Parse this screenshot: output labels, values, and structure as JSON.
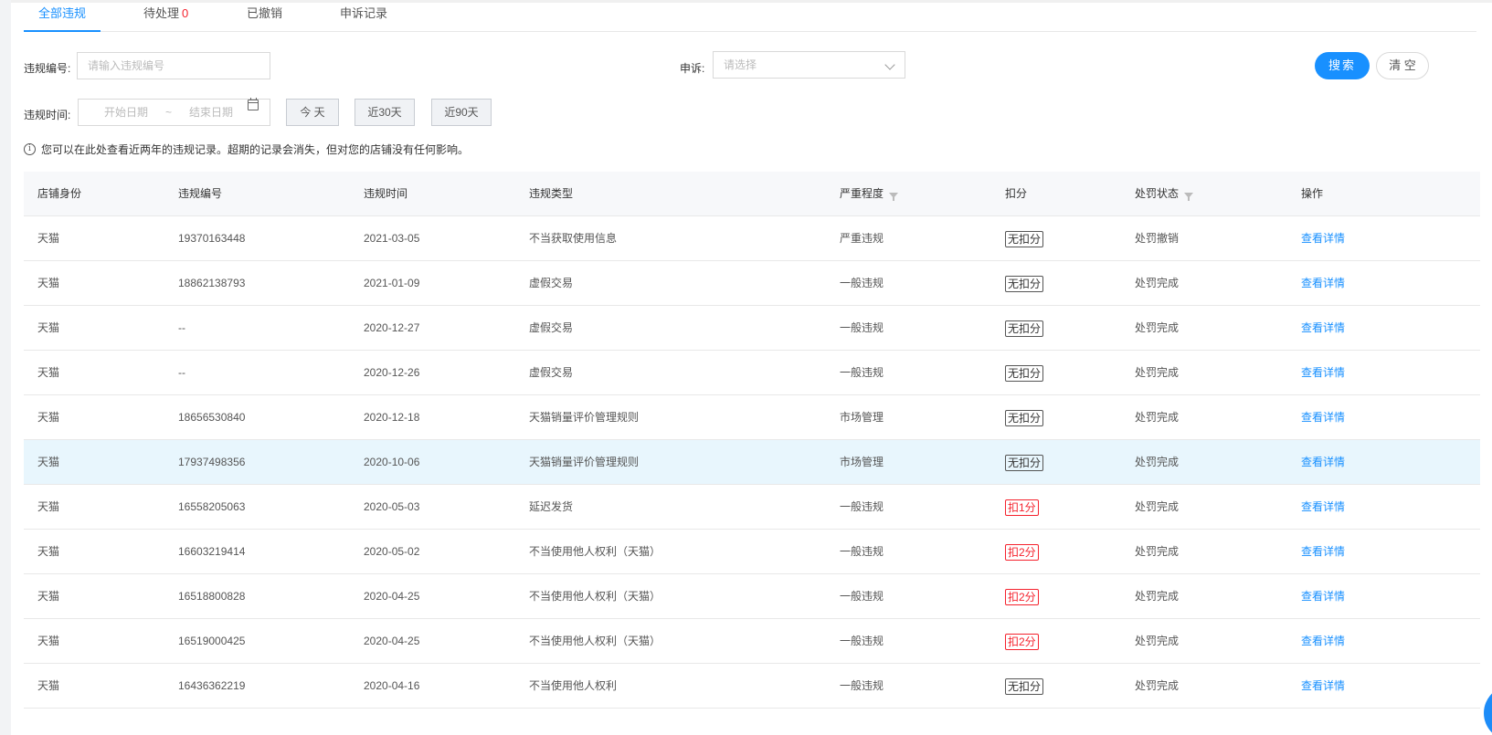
{
  "tabs": [
    {
      "label": "全部违规",
      "count": ""
    },
    {
      "label": "待处理",
      "count": "0"
    },
    {
      "label": "已撤销",
      "count": ""
    },
    {
      "label": "申诉记录",
      "count": ""
    }
  ],
  "filters": {
    "violation_no_label": "违规编号:",
    "violation_no_placeholder": "请输入违规编号",
    "appeal_label": "申诉:",
    "appeal_placeholder": "请选择",
    "time_label": "违规时间:",
    "start_date_placeholder": "开始日期",
    "range_sep": "~",
    "end_date_placeholder": "结束日期",
    "today_label": "今 天",
    "last30_label": "近30天",
    "last90_label": "近90天",
    "search_label": "搜索",
    "clear_label": "清 空"
  },
  "notice": "您可以在此处查看近两年的违规记录。超期的记录会消失，但对您的店铺没有任何影响。",
  "table": {
    "headers": [
      "店铺身份",
      "违规编号",
      "违规时间",
      "违规类型",
      "严重程度",
      "扣分",
      "处罚状态",
      "操作"
    ],
    "action_label": "查看详情",
    "rows": [
      {
        "shop": "天猫",
        "no": "19370163448",
        "time": "2021-03-05",
        "type": "不当获取使用信息",
        "severity": "严重违规",
        "points": "无扣分",
        "points_red": false,
        "status": "处罚撤销"
      },
      {
        "shop": "天猫",
        "no": "18862138793",
        "time": "2021-01-09",
        "type": "虚假交易",
        "severity": "一般违规",
        "points": "无扣分",
        "points_red": false,
        "status": "处罚完成"
      },
      {
        "shop": "天猫",
        "no": "--",
        "time": "2020-12-27",
        "type": "虚假交易",
        "severity": "一般违规",
        "points": "无扣分",
        "points_red": false,
        "status": "处罚完成"
      },
      {
        "shop": "天猫",
        "no": "--",
        "time": "2020-12-26",
        "type": "虚假交易",
        "severity": "一般违规",
        "points": "无扣分",
        "points_red": false,
        "status": "处罚完成"
      },
      {
        "shop": "天猫",
        "no": "18656530840",
        "time": "2020-12-18",
        "type": "天猫销量评价管理规则",
        "severity": "市场管理",
        "points": "无扣分",
        "points_red": false,
        "status": "处罚完成"
      },
      {
        "shop": "天猫",
        "no": "17937498356",
        "time": "2020-10-06",
        "type": "天猫销量评价管理规则",
        "severity": "市场管理",
        "points": "无扣分",
        "points_red": false,
        "status": "处罚完成"
      },
      {
        "shop": "天猫",
        "no": "16558205063",
        "time": "2020-05-03",
        "type": "延迟发货",
        "severity": "一般违规",
        "points": "扣1分",
        "points_red": true,
        "status": "处罚完成"
      },
      {
        "shop": "天猫",
        "no": "16603219414",
        "time": "2020-05-02",
        "type": "不当使用他人权利（天猫）",
        "severity": "一般违规",
        "points": "扣2分",
        "points_red": true,
        "status": "处罚完成"
      },
      {
        "shop": "天猫",
        "no": "16518800828",
        "time": "2020-04-25",
        "type": "不当使用他人权利（天猫）",
        "severity": "一般违规",
        "points": "扣2分",
        "points_red": true,
        "status": "处罚完成"
      },
      {
        "shop": "天猫",
        "no": "16519000425",
        "time": "2020-04-25",
        "type": "不当使用他人权利（天猫）",
        "severity": "一般违规",
        "points": "扣2分",
        "points_red": true,
        "status": "处罚完成"
      },
      {
        "shop": "天猫",
        "no": "16436362219",
        "time": "2020-04-16",
        "type": "不当使用他人权利",
        "severity": "一般违规",
        "points": "无扣分",
        "points_red": false,
        "status": "处罚完成"
      }
    ]
  },
  "colors": {
    "accent": "#1890ff",
    "danger": "#f5222d",
    "highlight_row": "#e8f6fd"
  }
}
